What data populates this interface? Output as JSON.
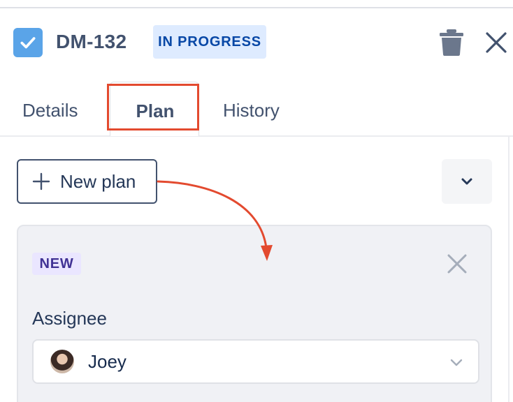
{
  "header": {
    "issue_key": "DM-132",
    "status": "IN PROGRESS",
    "icons": {
      "issue_type": "checkbox-icon",
      "delete": "trash-icon",
      "close": "close-icon"
    }
  },
  "tabs": [
    {
      "label": "Details",
      "active": false
    },
    {
      "label": "Plan",
      "active": true
    },
    {
      "label": "History",
      "active": false
    }
  ],
  "toolbar": {
    "new_plan_label": "New plan",
    "new_plan_icon": "plus-icon",
    "collapse_icon": "chevron-down-icon"
  },
  "plan_card": {
    "badge": "NEW",
    "assignee_label": "Assignee",
    "assignee_value": "Joey",
    "close_icon": "close-icon"
  },
  "colors": {
    "accent": "#5aa4e8",
    "status_bg": "#deebff",
    "status_text": "#0747a6",
    "new_badge_bg": "#eae6ff",
    "new_badge_text": "#403294",
    "annotation": "#e34a2f"
  }
}
